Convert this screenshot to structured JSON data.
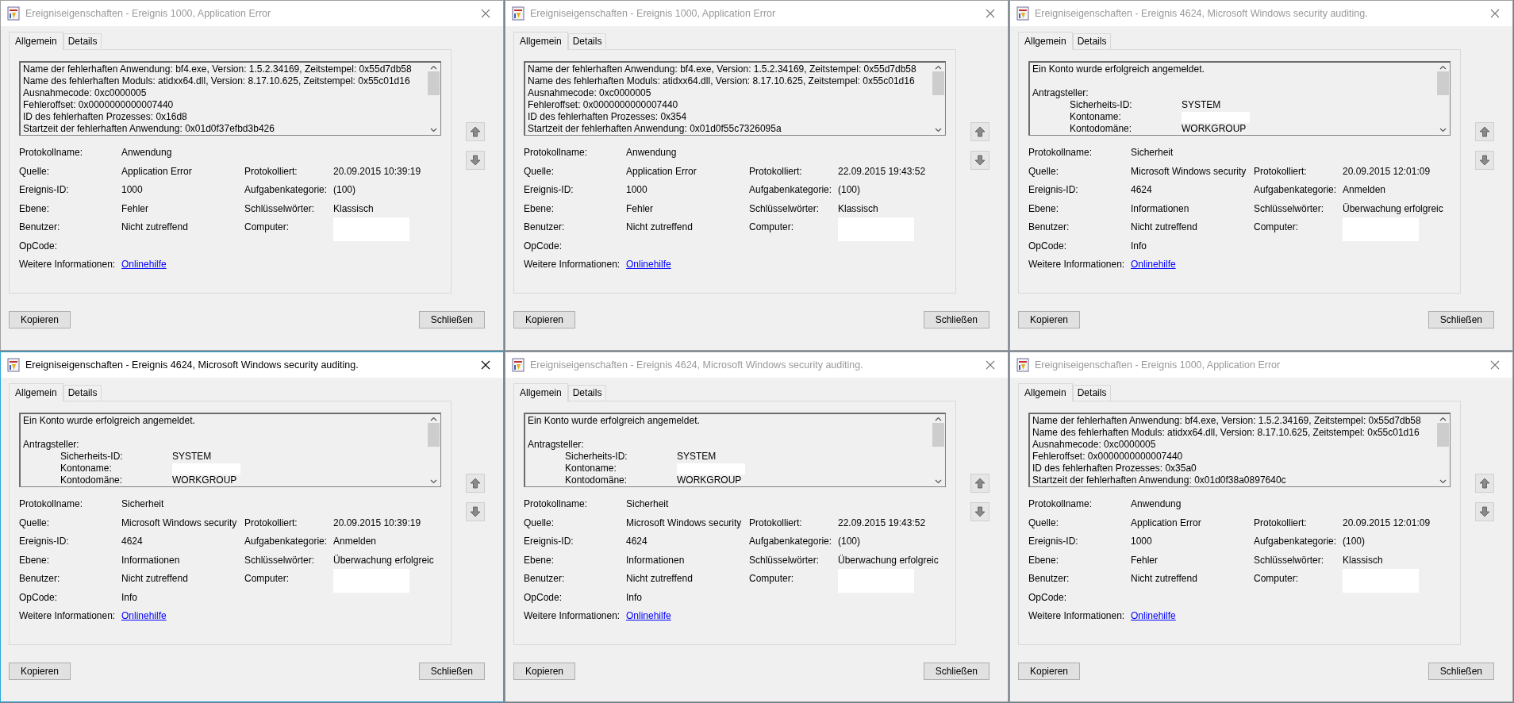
{
  "windows": [
    {
      "title": "Ereigniseigenschaften - Ereignis 1000, Application Error",
      "active": false,
      "tabs": [
        {
          "label": "Allgemein",
          "selected": true
        },
        {
          "label": "Details",
          "selected": false
        }
      ],
      "description": [
        {
          "kind": "text",
          "text": "Name der fehlerhaften Anwendung: bf4.exe, Version: 1.5.2.34169, Zeitstempel: 0x55d7db58"
        },
        {
          "kind": "text",
          "text": "Name des fehlerhaften Moduls: atidxx64.dll, Version: 8.17.10.625, Zeitstempel: 0x55c01d16"
        },
        {
          "kind": "text",
          "text": "Ausnahmecode: 0xc0000005"
        },
        {
          "kind": "text",
          "text": "Fehleroffset: 0x0000000000007440"
        },
        {
          "kind": "text",
          "text": "ID des fehlerhaften Prozesses: 0x16d8"
        },
        {
          "kind": "text",
          "text": "Startzeit der fehlerhaften Anwendung: 0x01d0f37efbd3b426"
        }
      ],
      "rows": [
        [
          {
            "label": "Protokollname:",
            "value": "Anwendung"
          }
        ],
        [
          {
            "label": "Quelle:",
            "value": "Application Error"
          },
          {
            "label": "Protokolliert:",
            "value": "20.09.2015 10:39:19"
          }
        ],
        [
          {
            "label": "Ereignis-ID:",
            "value": "1000"
          },
          {
            "label": "Aufgabenkategorie:",
            "value": "(100)"
          }
        ],
        [
          {
            "label": "Ebene:",
            "value": "Fehler"
          },
          {
            "label": "Schlüsselwörter:",
            "value": "Klassisch"
          }
        ],
        [
          {
            "label": "Benutzer:",
            "value": "Nicht zutreffend"
          },
          {
            "label": "Computer:",
            "redacted": true
          }
        ],
        [
          {
            "label": "OpCode:"
          }
        ],
        [
          {
            "label": "Weitere Informationen:",
            "link": "Onlinehilfe"
          }
        ]
      ],
      "buttons": [
        "Kopieren",
        "Schließen"
      ]
    },
    {
      "title": "Ereigniseigenschaften - Ereignis 1000, Application Error",
      "active": false,
      "tabs": [
        {
          "label": "Allgemein",
          "selected": true
        },
        {
          "label": "Details",
          "selected": false
        }
      ],
      "description": [
        {
          "kind": "text",
          "text": "Name der fehlerhaften Anwendung: bf4.exe, Version: 1.5.2.34169, Zeitstempel: 0x55d7db58"
        },
        {
          "kind": "text",
          "text": "Name des fehlerhaften Moduls: atidxx64.dll, Version: 8.17.10.625, Zeitstempel: 0x55c01d16"
        },
        {
          "kind": "text",
          "text": "Ausnahmecode: 0xc0000005"
        },
        {
          "kind": "text",
          "text": "Fehleroffset: 0x0000000000007440"
        },
        {
          "kind": "text",
          "text": "ID des fehlerhaften Prozesses: 0x354"
        },
        {
          "kind": "text",
          "text": "Startzeit der fehlerhaften Anwendung: 0x01d0f55c7326095a"
        }
      ],
      "rows": [
        [
          {
            "label": "Protokollname:",
            "value": "Anwendung"
          }
        ],
        [
          {
            "label": "Quelle:",
            "value": "Application Error"
          },
          {
            "label": "Protokolliert:",
            "value": "22.09.2015 19:43:52"
          }
        ],
        [
          {
            "label": "Ereignis-ID:",
            "value": "1000"
          },
          {
            "label": "Aufgabenkategorie:",
            "value": "(100)"
          }
        ],
        [
          {
            "label": "Ebene:",
            "value": "Fehler"
          },
          {
            "label": "Schlüsselwörter:",
            "value": "Klassisch"
          }
        ],
        [
          {
            "label": "Benutzer:",
            "value": "Nicht zutreffend"
          },
          {
            "label": "Computer:",
            "redacted": true
          }
        ],
        [
          {
            "label": "OpCode:"
          }
        ],
        [
          {
            "label": "Weitere Informationen:",
            "link": "Onlinehilfe"
          }
        ]
      ],
      "buttons": [
        "Kopieren",
        "Schließen"
      ]
    },
    {
      "title": "Ereigniseigenschaften - Ereignis 4624, Microsoft Windows security auditing.",
      "active": false,
      "tabs": [
        {
          "label": "Allgemein",
          "selected": true
        },
        {
          "label": "Details",
          "selected": false
        }
      ],
      "description": [
        {
          "kind": "text",
          "text": "Ein Konto wurde erfolgreich angemeldet."
        },
        {
          "kind": "blank"
        },
        {
          "kind": "text",
          "text": "Antragsteller:"
        },
        {
          "kind": "pair",
          "label": "Sicherheits-ID:",
          "value": "SYSTEM"
        },
        {
          "kind": "pair",
          "label": "Kontoname:",
          "redacted": true
        },
        {
          "kind": "pair",
          "label": "Kontodomäne:",
          "value": "WORKGROUP"
        }
      ],
      "rows": [
        [
          {
            "label": "Protokollname:",
            "value": "Sicherheit"
          }
        ],
        [
          {
            "label": "Quelle:",
            "value": "Microsoft Windows security"
          },
          {
            "label": "Protokolliert:",
            "value": "20.09.2015 12:01:09"
          }
        ],
        [
          {
            "label": "Ereignis-ID:",
            "value": "4624"
          },
          {
            "label": "Aufgabenkategorie:",
            "value": "Anmelden"
          }
        ],
        [
          {
            "label": "Ebene:",
            "value": "Informationen"
          },
          {
            "label": "Schlüsselwörter:",
            "value": "Überwachung erfolgreic"
          }
        ],
        [
          {
            "label": "Benutzer:",
            "value": "Nicht zutreffend"
          },
          {
            "label": "Computer:",
            "redacted": true
          }
        ],
        [
          {
            "label": "OpCode:",
            "value": "Info"
          }
        ],
        [
          {
            "label": "Weitere Informationen:",
            "link": "Onlinehilfe"
          }
        ]
      ],
      "buttons": [
        "Kopieren",
        "Schließen"
      ]
    },
    {
      "title": "Ereigniseigenschaften - Ereignis 4624, Microsoft Windows security auditing.",
      "active": true,
      "tabs": [
        {
          "label": "Allgemein",
          "selected": true
        },
        {
          "label": "Details",
          "selected": false
        }
      ],
      "description": [
        {
          "kind": "text",
          "text": "Ein Konto wurde erfolgreich angemeldet."
        },
        {
          "kind": "blank"
        },
        {
          "kind": "text",
          "text": "Antragsteller:"
        },
        {
          "kind": "pair",
          "label": "Sicherheits-ID:",
          "value": "SYSTEM"
        },
        {
          "kind": "pair",
          "label": "Kontoname:",
          "redacted": true
        },
        {
          "kind": "pair",
          "label": "Kontodomäne:",
          "value": "WORKGROUP"
        }
      ],
      "rows": [
        [
          {
            "label": "Protokollname:",
            "value": "Sicherheit"
          }
        ],
        [
          {
            "label": "Quelle:",
            "value": "Microsoft Windows security"
          },
          {
            "label": "Protokolliert:",
            "value": "20.09.2015 10:39:19"
          }
        ],
        [
          {
            "label": "Ereignis-ID:",
            "value": "4624"
          },
          {
            "label": "Aufgabenkategorie:",
            "value": "Anmelden"
          }
        ],
        [
          {
            "label": "Ebene:",
            "value": "Informationen"
          },
          {
            "label": "Schlüsselwörter:",
            "value": "Überwachung erfolgreic"
          }
        ],
        [
          {
            "label": "Benutzer:",
            "value": "Nicht zutreffend"
          },
          {
            "label": "Computer:",
            "redacted": true
          }
        ],
        [
          {
            "label": "OpCode:",
            "value": "Info"
          }
        ],
        [
          {
            "label": "Weitere Informationen:",
            "link": "Onlinehilfe"
          }
        ]
      ],
      "buttons": [
        "Kopieren",
        "Schließen"
      ]
    },
    {
      "title": "Ereigniseigenschaften - Ereignis 4624, Microsoft Windows security auditing.",
      "active": false,
      "tabs": [
        {
          "label": "Allgemein",
          "selected": true
        },
        {
          "label": "Details",
          "selected": false
        }
      ],
      "description": [
        {
          "kind": "text",
          "text": "Ein Konto wurde erfolgreich angemeldet."
        },
        {
          "kind": "blank"
        },
        {
          "kind": "text",
          "text": "Antragsteller:"
        },
        {
          "kind": "pair",
          "label": "Sicherheits-ID:",
          "value": "SYSTEM"
        },
        {
          "kind": "pair",
          "label": "Kontoname:",
          "redacted": true
        },
        {
          "kind": "pair",
          "label": "Kontodomäne:",
          "value": "WORKGROUP"
        }
      ],
      "rows": [
        [
          {
            "label": "Protokollname:",
            "value": "Sicherheit"
          }
        ],
        [
          {
            "label": "Quelle:",
            "value": "Microsoft Windows security"
          },
          {
            "label": "Protokolliert:",
            "value": "22.09.2015 19:43:52"
          }
        ],
        [
          {
            "label": "Ereignis-ID:",
            "value": "4624"
          },
          {
            "label": "Aufgabenkategorie:",
            "value": "(100)"
          }
        ],
        [
          {
            "label": "Ebene:",
            "value": "Informationen"
          },
          {
            "label": "Schlüsselwörter:",
            "value": "Überwachung erfolgreic"
          }
        ],
        [
          {
            "label": "Benutzer:",
            "value": "Nicht zutreffend"
          },
          {
            "label": "Computer:",
            "redacted": true
          }
        ],
        [
          {
            "label": "OpCode:",
            "value": "Info"
          }
        ],
        [
          {
            "label": "Weitere Informationen:",
            "link": "Onlinehilfe"
          }
        ]
      ],
      "buttons": [
        "Kopieren",
        "Schließen"
      ]
    },
    {
      "title": "Ereigniseigenschaften - Ereignis 1000, Application Error",
      "active": false,
      "tabs": [
        {
          "label": "Allgemein",
          "selected": true
        },
        {
          "label": "Details",
          "selected": false
        }
      ],
      "description": [
        {
          "kind": "text",
          "text": "Name der fehlerhaften Anwendung: bf4.exe, Version: 1.5.2.34169, Zeitstempel: 0x55d7db58"
        },
        {
          "kind": "text",
          "text": "Name des fehlerhaften Moduls: atidxx64.dll, Version: 8.17.10.625, Zeitstempel: 0x55c01d16"
        },
        {
          "kind": "text",
          "text": "Ausnahmecode: 0xc0000005"
        },
        {
          "kind": "text",
          "text": "Fehleroffset: 0x0000000000007440"
        },
        {
          "kind": "text",
          "text": "ID des fehlerhaften Prozesses: 0x35a0"
        },
        {
          "kind": "text",
          "text": "Startzeit der fehlerhaften Anwendung: 0x01d0f38a0897640c"
        }
      ],
      "rows": [
        [
          {
            "label": "Protokollname:",
            "value": "Anwendung"
          }
        ],
        [
          {
            "label": "Quelle:",
            "value": "Application Error"
          },
          {
            "label": "Protokolliert:",
            "value": "20.09.2015 12:01:09"
          }
        ],
        [
          {
            "label": "Ereignis-ID:",
            "value": "1000"
          },
          {
            "label": "Aufgabenkategorie:",
            "value": "(100)"
          }
        ],
        [
          {
            "label": "Ebene:",
            "value": "Fehler"
          },
          {
            "label": "Schlüsselwörter:",
            "value": "Klassisch"
          }
        ],
        [
          {
            "label": "Benutzer:",
            "value": "Nicht zutreffend"
          },
          {
            "label": "Computer:",
            "redacted": true
          }
        ],
        [
          {
            "label": "OpCode:"
          }
        ],
        [
          {
            "label": "Weitere Informationen:",
            "link": "Onlinehilfe"
          }
        ]
      ],
      "buttons": [
        "Kopieren",
        "Schließen"
      ]
    }
  ]
}
